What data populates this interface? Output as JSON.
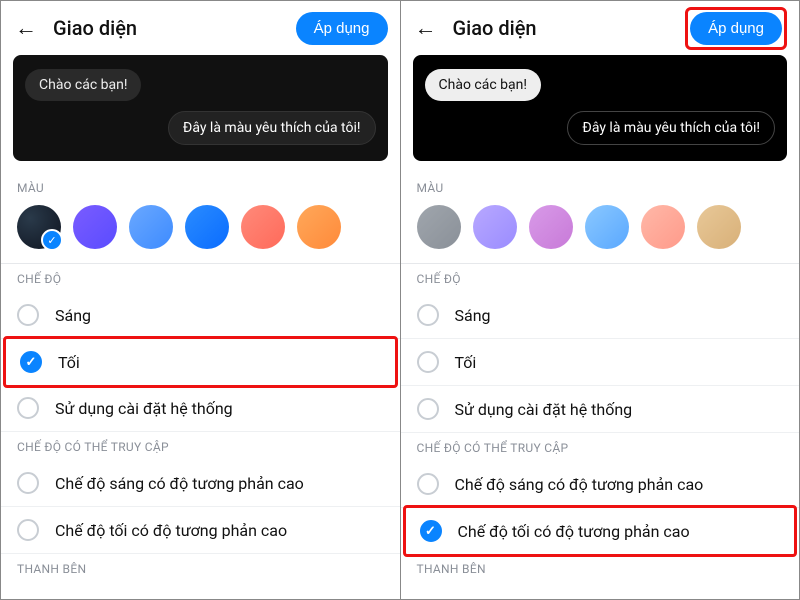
{
  "header": {
    "title": "Giao diện",
    "apply_label": "Áp dụng"
  },
  "preview": {
    "incoming": "Chào các bạn!",
    "outgoing": "Đây là màu yêu thích của tôi!"
  },
  "sections": {
    "color_label": "MÀU",
    "mode_label": "CHẾ ĐỘ",
    "accessible_label": "CHẾ ĐỘ CÓ THỂ TRUY CẬP",
    "bottom_label": "THANH BÊN"
  },
  "left": {
    "swatches": [
      {
        "name": "dark",
        "bg": "radial-gradient(circle at 30% 30%, #2a3a4a, #0e1420)",
        "selected": true
      },
      {
        "name": "purple",
        "bg": "linear-gradient(135deg, #7a5cff, #5a4cff)"
      },
      {
        "name": "blue-light",
        "bg": "linear-gradient(135deg, #6aa8ff, #3d8bff)"
      },
      {
        "name": "blue",
        "bg": "linear-gradient(135deg, #2a8cff, #0a6cff)"
      },
      {
        "name": "coral",
        "bg": "linear-gradient(135deg, #ff8a7a, #ff6a5a)"
      },
      {
        "name": "orange",
        "bg": "linear-gradient(135deg, #ffa85a, #ff8a3a)"
      }
    ],
    "modes": {
      "light": "Sáng",
      "dark": "Tối",
      "system": "Sử dụng cài đặt hệ thống"
    },
    "accessible": {
      "light_hc": "Chế độ sáng có độ tương phản cao",
      "dark_hc": "Chế độ tối có độ tương phản cao"
    }
  },
  "right": {
    "swatches": [
      {
        "name": "grey",
        "bg": "linear-gradient(135deg, #a0a6ad, #8a9098)"
      },
      {
        "name": "lavender",
        "bg": "linear-gradient(135deg, #b8a8ff, #9a8cff)"
      },
      {
        "name": "pink",
        "bg": "linear-gradient(135deg, #d89ae8, #c87ad8)"
      },
      {
        "name": "sky",
        "bg": "linear-gradient(135deg, #8ac8ff, #5aa8ff)"
      },
      {
        "name": "peach",
        "bg": "linear-gradient(135deg, #ffb8a8, #ff9a8a)"
      },
      {
        "name": "tan",
        "bg": "linear-gradient(135deg, #e8c898, #d8b078)"
      }
    ],
    "modes": {
      "light": "Sáng",
      "dark": "Tối",
      "system": "Sử dụng cài đặt hệ thống"
    },
    "accessible": {
      "light_hc": "Chế độ sáng có độ tương phản cao",
      "dark_hc": "Chế độ tối có độ tương phản cao"
    }
  }
}
